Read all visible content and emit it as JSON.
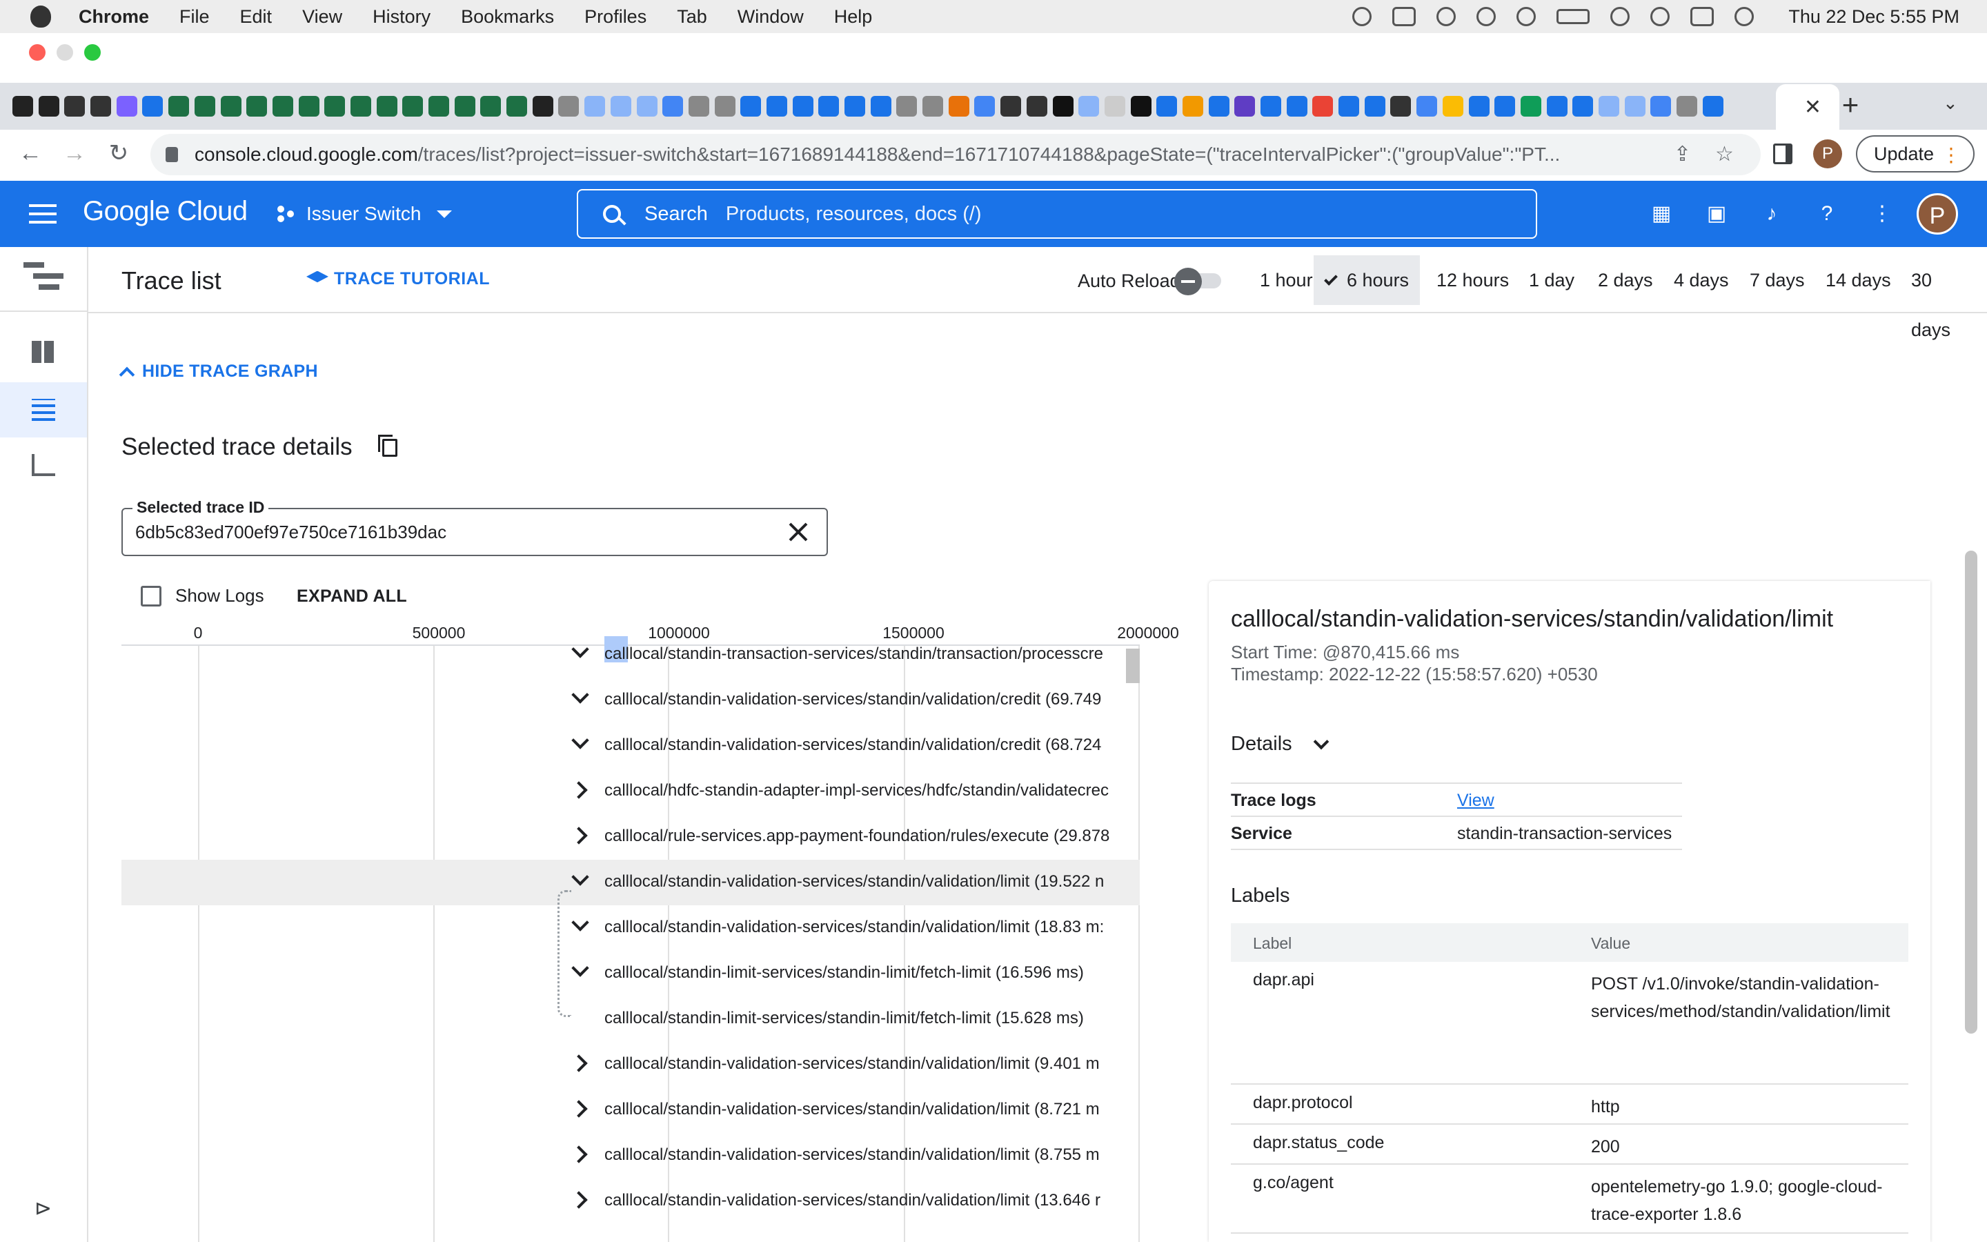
{
  "menubar": {
    "app": "Chrome",
    "items": [
      "File",
      "Edit",
      "View",
      "History",
      "Bookmarks",
      "Profiles",
      "Tab",
      "Window",
      "Help"
    ],
    "clock": "Thu 22 Dec  5:55 PM"
  },
  "browser": {
    "active_tab_close": "✕",
    "new_tab": "+",
    "url_host": "console.cloud.google.com",
    "url_path": "/traces/list?project=issuer-switch&start=1671689144188&end=1671710744188&pageState=(\"traceIntervalPicker\":(\"groupValue\":\"PT...",
    "profile_initial": "P",
    "update_label": "Update",
    "update_kebab": "⋮"
  },
  "gc_header": {
    "logo": "Google Cloud",
    "project": "Issuer Switch",
    "search_label": "Search",
    "search_hint": "Products, resources, docs (/)",
    "avatar_initial": "P"
  },
  "page": {
    "title": "Trace list",
    "tutorial_label": "TRACE TUTORIAL",
    "auto_reload_label": "Auto Reload",
    "ranges": [
      "1 hour",
      "6 hours",
      "12 hours",
      "1 day",
      "2 days",
      "4 days",
      "7 days",
      "14 days",
      "30 days"
    ],
    "selected_range": "6 hours"
  },
  "content": {
    "hide_graph_label": "HIDE TRACE GRAPH",
    "details_title": "Selected trace details",
    "trace_id_label": "Selected trace ID",
    "trace_id_value": "6db5c83ed700ef97e750ce7161b39dac",
    "show_logs_label": "Show Logs",
    "expand_all_label": "EXPAND ALL"
  },
  "timeline": {
    "axis_ticks": [
      "0",
      "500000",
      "1000000",
      "1500000",
      "2000000"
    ],
    "spans": [
      {
        "name": "calllocal/standin-transaction-services/standin/transaction/processcre",
        "toggle": "down"
      },
      {
        "name": "calllocal/standin-validation-services/standin/validation/credit (69.749",
        "toggle": "down"
      },
      {
        "name": "calllocal/standin-validation-services/standin/validation/credit (68.724",
        "toggle": "down"
      },
      {
        "name": "calllocal/hdfc-standin-adapter-impl-services/hdfc/standin/validatecrec",
        "toggle": "right"
      },
      {
        "name": "calllocal/rule-services.app-payment-foundation/rules/execute (29.878",
        "toggle": "right"
      },
      {
        "name": "calllocal/standin-validation-services/standin/validation/limit (19.522 n",
        "toggle": "down"
      },
      {
        "name": "calllocal/standin-validation-services/standin/validation/limit (18.83 m:",
        "toggle": "down"
      },
      {
        "name": "calllocal/standin-limit-services/standin-limit/fetch-limit (16.596 ms)",
        "toggle": "down"
      },
      {
        "name": "calllocal/standin-limit-services/standin-limit/fetch-limit (15.628 ms)",
        "toggle": "none"
      },
      {
        "name": "calllocal/standin-validation-services/standin/validation/limit (9.401 m",
        "toggle": "right"
      },
      {
        "name": "calllocal/standin-validation-services/standin/validation/limit (8.721 m",
        "toggle": "right"
      },
      {
        "name": "calllocal/standin-validation-services/standin/validation/limit (8.755 m",
        "toggle": "right"
      },
      {
        "name": "calllocal/standin-validation-services/standin/validation/limit (13.646 r",
        "toggle": "right"
      }
    ]
  },
  "details": {
    "span_title": "calllocal/standin-validation-services/standin/validation/limit",
    "start_time": "Start Time: @870,415.66 ms",
    "timestamp": "Timestamp: 2022-12-22 (15:58:57.620) +0530",
    "details_label": "Details",
    "trace_logs_key": "Trace logs",
    "trace_logs_value": "View",
    "service_key": "Service",
    "service_value": "standin-transaction-services",
    "labels_title": "Labels",
    "labels_header": {
      "label": "Label",
      "value": "Value"
    },
    "labels": [
      {
        "key": "dapr.api",
        "value": "POST /v1.0/invoke/standin-validation-services/method/standin/validation/limit"
      },
      {
        "key": "dapr.protocol",
        "value": "http"
      },
      {
        "key": "dapr.status_code",
        "value": "200"
      },
      {
        "key": "g.co/agent",
        "value": "opentelemetry-go 1.9.0; google-cloud-trace-exporter 1.8.6"
      }
    ]
  }
}
